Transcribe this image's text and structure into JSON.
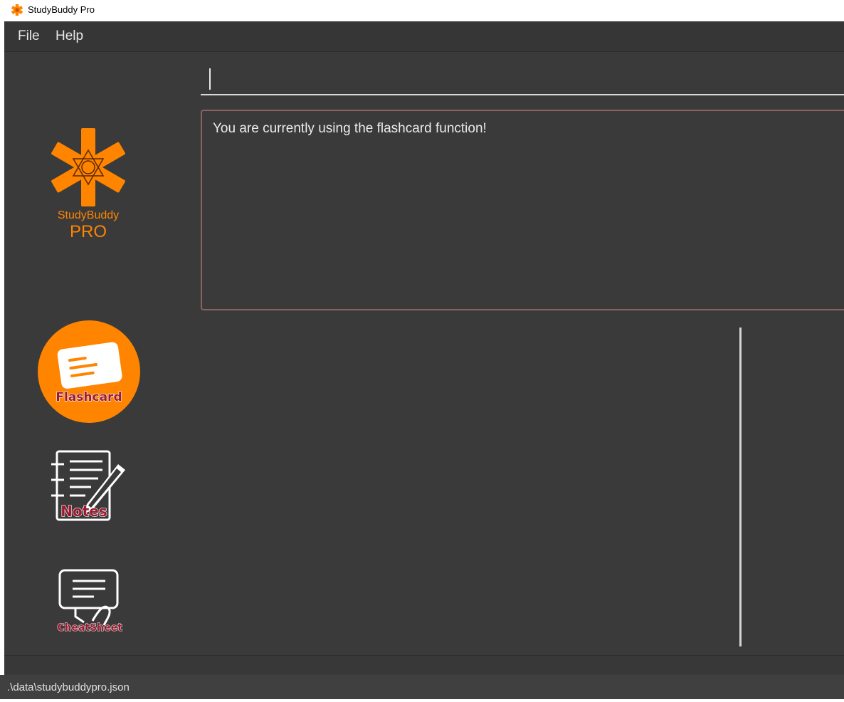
{
  "window": {
    "title": "StudyBuddy Pro"
  },
  "menu": {
    "file": "File",
    "help": "Help"
  },
  "logo": {
    "line1": "StudyBuddy",
    "line2": "PRO"
  },
  "sidebar": {
    "flashcard": "Flashcard",
    "notes": "Notes",
    "cheatsheet": "CheatSheet"
  },
  "command": {
    "value": ""
  },
  "result": {
    "message": "You are currently using the flashcard function!"
  },
  "status": {
    "path": ".\\data\\studybuddypro.json"
  },
  "colors": {
    "accent": "#ff8400",
    "background": "#3a3a3a",
    "label_red": "#9b1b30"
  }
}
